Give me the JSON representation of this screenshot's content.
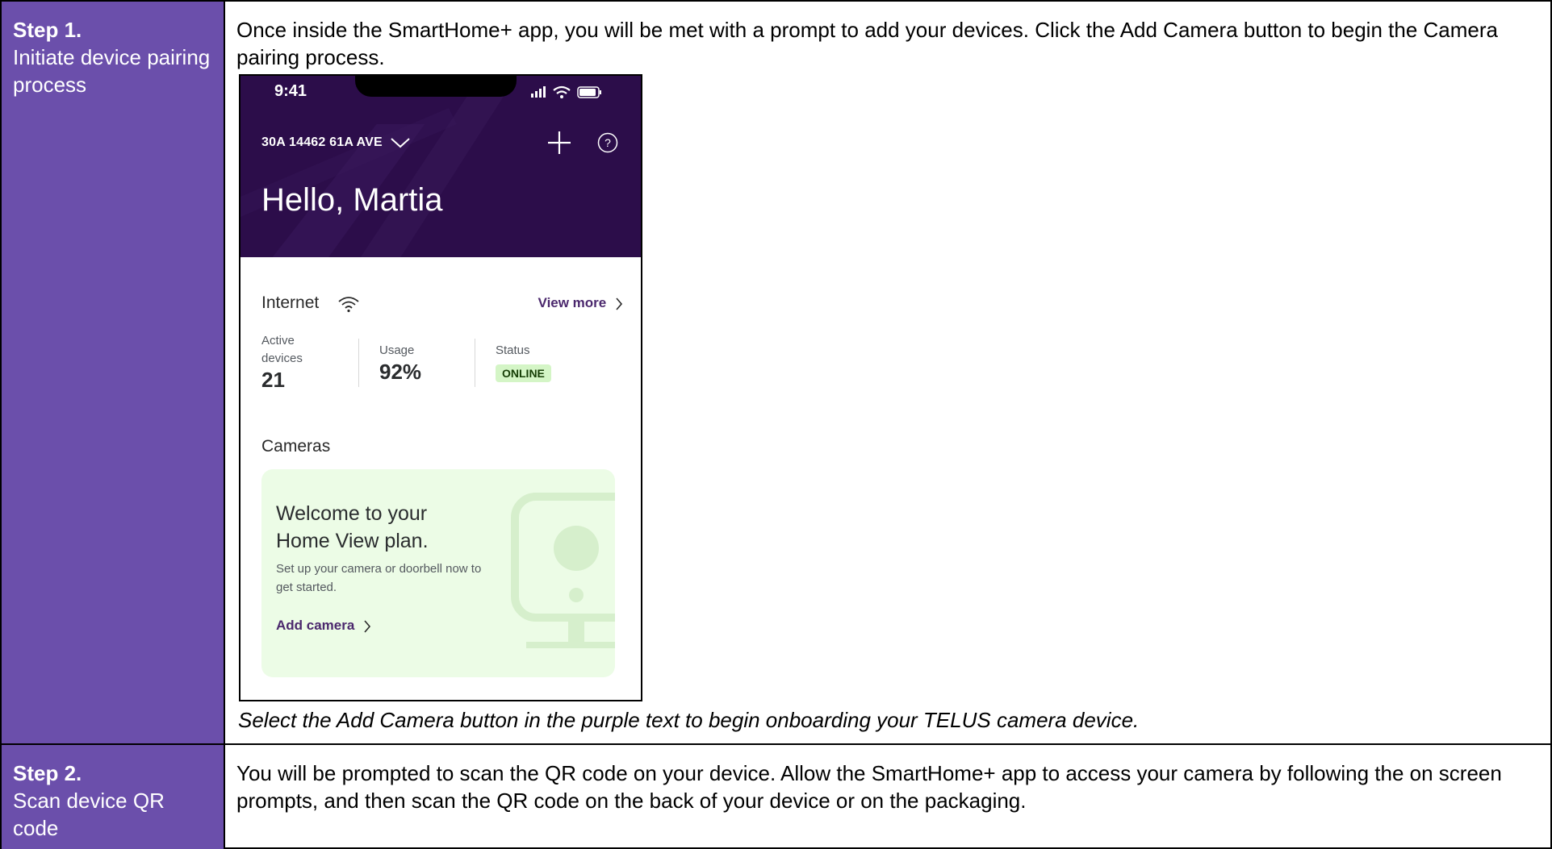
{
  "rows": [
    {
      "step_title": "Step 1.",
      "step_desc": "Initiate device pairing process",
      "text": "Once inside the SmartHome+ app, you will be met with a prompt to add your devices. Click the Add Camera button to begin the Camera pairing process.",
      "caption": "Select the Add Camera button in the purple text to begin onboarding your TELUS camera device."
    },
    {
      "step_title": "Step 2.",
      "step_desc": "Scan device QR code",
      "text": "You will be prompted to scan the QR code on your device. Allow the SmartHome+ app to access your camera by following the on screen prompts, and then scan the QR code on the back of your device or on the packaging."
    }
  ],
  "phone": {
    "time": "9:41",
    "address": "30A 14462 61A AVE",
    "greeting": "Hello, Martia",
    "internet_label": "Internet",
    "view_more": "View more",
    "stats": {
      "active_label": "Active devices",
      "active_value": "21",
      "usage_label": "Usage",
      "usage_value": "92%",
      "status_label": "Status",
      "status_value": "ONLINE"
    },
    "cameras_title": "Cameras",
    "promo_title": "Welcome to your Home View plan.",
    "promo_sub": "Set up your camera or doorbell now to get started.",
    "promo_link": "Add camera"
  },
  "colors": {
    "step_cell": "#6b4fab",
    "phone_header": "#2c0d4a",
    "link_purple": "#4b286d",
    "promo_bg": "#ecfce6",
    "badge_bg": "#d4f5c6"
  }
}
